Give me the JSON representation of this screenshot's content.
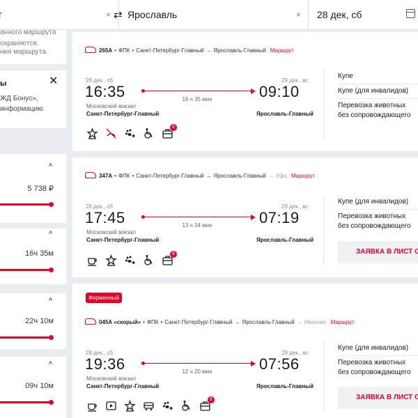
{
  "search": {
    "from": "г",
    "to": "Ярославль",
    "date": "28 дек, сб",
    "clear_symbol": "×",
    "swap_symbol": "⇄"
  },
  "sidebar": {
    "notice_lines": [
      "анного маршрута",
      "охраняется.",
      "ния маршрута."
    ],
    "bonus": {
      "title": "ы",
      "lines": [
        "ЖД Бонус»,",
        "информацию"
      ],
      "close": "✕"
    },
    "filters": [
      {
        "value": "5 738 ₽",
        "chevron": "^"
      },
      {
        "value": "16ч 35м",
        "chevron": "^"
      },
      {
        "value": "22ч 10м",
        "chevron": "^"
      },
      {
        "value": "09ч 10м",
        "chevron": "^"
      }
    ]
  },
  "trains": [
    {
      "badge": "",
      "number": "265А",
      "carrier": "ФПК",
      "from": "Санкт-Петербург-Главный",
      "to": "Ярославль-Главный",
      "via": "",
      "route_link": "Маршрут",
      "dep_date": "28 дек., сб",
      "dep_time": "16:35",
      "arr_date": "29 дек., вс",
      "arr_time": "09:10",
      "duration": "16 ч 35 мин",
      "dep_vokzal": "Московский вокзал",
      "dep_station": "Санкт-Петербург-Главный",
      "arr_station": "Ярославль-Главный",
      "classes": [
        "Купе",
        "Купе (для инвалидов)",
        "Перевозка животных\nбез сопровождающего"
      ],
      "waitlist": "",
      "icons": [
        "star-icon",
        "no-pets-icon",
        "pet-transfer-icon",
        "wheelchair-icon",
        "luggage-icon"
      ],
      "luggage_count": "8"
    },
    {
      "badge": "",
      "number": "347А",
      "carrier": "ФПК",
      "from": "Санкт-Петербург-Главный",
      "to": "Ярославль-Главный",
      "via": "Уфа",
      "route_link": "Маршрут",
      "dep_date": "28 дек., сб",
      "dep_time": "17:45",
      "arr_date": "29 дек., вс",
      "arr_time": "07:19",
      "duration": "13 ч 34 мин",
      "dep_vokzal": "Московский вокзал",
      "dep_station": "Санкт-Петербург-Главный",
      "arr_station": "Ярославль-Главный",
      "classes": [
        "Купе (для инвалидов)",
        "Перевозка животных\nбез сопровождающего"
      ],
      "waitlist": "ЗАЯВКА В ЛИСТ О",
      "icons": [
        "coffee-icon",
        "star-icon",
        "pet-transfer-icon",
        "wheelchair-icon",
        "luggage-icon"
      ],
      "luggage_count": "8"
    },
    {
      "badge": "Фирменный",
      "number": "045А «скорый»",
      "carrier": "ФПК",
      "from": "Санкт-Петербург-Главный",
      "to": "Ярославль-Главный",
      "via": "Иваново",
      "route_link": "Маршрут",
      "dep_date": "28 дек., сб",
      "dep_time": "19:36",
      "arr_date": "29 дек., вс",
      "arr_time": "07:56",
      "duration": "12 ч 20 мин",
      "dep_vokzal": "Московский вокзал",
      "dep_station": "Санкт-Петербург-Главный",
      "arr_station": "Ярославль-Главный",
      "classes": [
        "Купе (для инвалидов)",
        "Перевозка животных\nбез сопровождающего"
      ],
      "waitlist": "ЗАЯВКА В ЛИСТ О",
      "icons": [
        "coffee-icon",
        "video-icon",
        "star-icon",
        "train-car-icon",
        "pet-transfer-icon",
        "wheelchair-icon",
        "luggage-icon"
      ],
      "luggage_count": "8"
    }
  ],
  "colors": {
    "accent": "#e4002b",
    "background": "#e9ecf1"
  }
}
